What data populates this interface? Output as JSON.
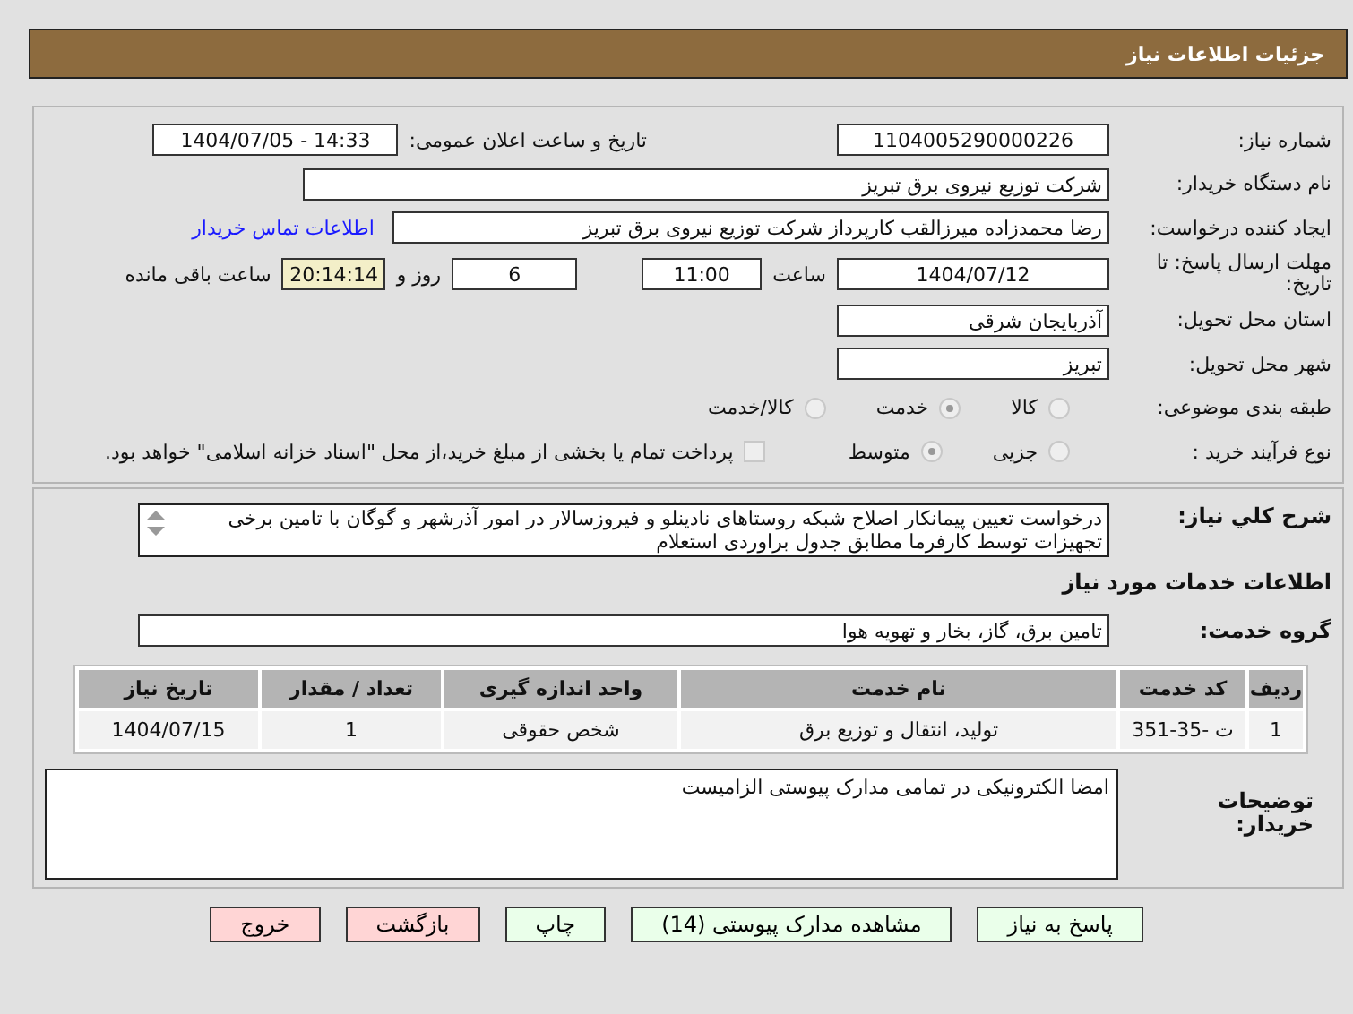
{
  "header": {
    "title": "جزئیات اطلاعات نیاز"
  },
  "need_number": {
    "label": "شماره نیاز:",
    "value": "1104005290000226"
  },
  "announce": {
    "label": "تاریخ و ساعت اعلان عمومی:",
    "value": "1404/07/05 - 14:33"
  },
  "buyer_org": {
    "label": "نام دستگاه خریدار:",
    "value": "شرکت توزیع نیروی برق تبریز"
  },
  "creator": {
    "label": "ایجاد کننده درخواست:",
    "value": "رضا محمدزاده میرزالقب کارپرداز شرکت توزیع نیروی برق تبریز",
    "link": "اطلاعات تماس خریدار"
  },
  "deadline": {
    "label": "مهلت ارسال پاسخ: تا تاریخ:",
    "date": "1404/07/12",
    "time_label": "ساعت",
    "time": "11:00",
    "days": "6",
    "days_label": "روز و",
    "remaining": "20:14:14",
    "remaining_label": "ساعت باقی مانده"
  },
  "province": {
    "label": "استان محل تحویل:",
    "value": "آذربایجان شرقی"
  },
  "city": {
    "label": "شهر محل تحویل:",
    "value": "تبریز"
  },
  "category": {
    "label": "طبقه بندی موضوعی:",
    "options": [
      {
        "label": "کالا",
        "selected": false
      },
      {
        "label": "خدمت",
        "selected": true
      },
      {
        "label": "کالا/خدمت",
        "selected": false
      }
    ]
  },
  "purchase_type": {
    "label": "نوع فرآیند خرید :",
    "options": [
      {
        "label": "جزیی",
        "selected": false
      },
      {
        "label": "متوسط",
        "selected": true
      }
    ],
    "payment_checkbox": {
      "checked": false,
      "label": "پرداخت تمام یا بخشی از مبلغ خرید،از محل \"اسناد خزانه اسلامی\" خواهد بود."
    }
  },
  "description": {
    "label": "شرح كلي نیاز:",
    "value": "درخواست تعیین پیمانکار اصلاح شبکه روستاهای نادینلو و فیروزسالار در امور آذرشهر و گوگان با تامین برخی تجهیزات توسط کارفرما مطابق جدول براوردی استعلام"
  },
  "services_title": "اطلاعات خدمات مورد نیاز",
  "service_group": {
    "label": "گروه خدمت:",
    "value": "تامین برق، گاز، بخار و تهویه هوا"
  },
  "table": {
    "columns": [
      "ردیف",
      "کد خدمت",
      "نام خدمت",
      "واحد اندازه گیری",
      "تعداد / مقدار",
      "تاریخ نیاز"
    ],
    "rows": [
      [
        "1",
        "ت -35-351",
        "تولید، انتقال و توزیع برق",
        "شخص حقوقی",
        "1",
        "1404/07/15"
      ]
    ]
  },
  "buyer_notes": {
    "label": "توضیحات خریدار:",
    "value": "امضا الکترونیکی در تمامی مدارک پیوستی الزامیست"
  },
  "buttons": [
    {
      "label": "پاسخ به نیاز",
      "kind": "green"
    },
    {
      "label": "مشاهده مدارک پیوستی (14)",
      "kind": "green"
    },
    {
      "label": "چاپ",
      "kind": "green"
    },
    {
      "label": "بازگشت",
      "kind": "pink"
    },
    {
      "label": "خروج",
      "kind": "pink"
    }
  ]
}
